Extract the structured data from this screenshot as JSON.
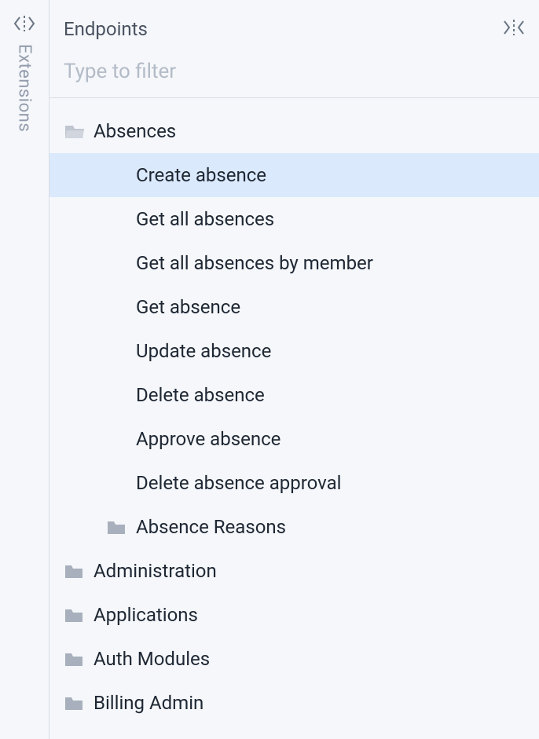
{
  "vertical_tab": {
    "label": "Extensions"
  },
  "panel": {
    "title": "Endpoints"
  },
  "filter": {
    "placeholder": "Type to filter",
    "value": ""
  },
  "tree": {
    "folder_open": {
      "label": "Absences"
    },
    "endpoints": [
      "Create absence",
      "Get all absences",
      "Get all absences by member",
      "Get absence",
      "Update absence",
      "Delete absence",
      "Approve absence",
      "Delete absence approval"
    ],
    "selected_index": 0,
    "subfolder": {
      "label": "Absence Reasons"
    },
    "closed_folders": [
      "Administration",
      "Applications",
      "Auth Modules",
      "Billing Admin"
    ]
  }
}
